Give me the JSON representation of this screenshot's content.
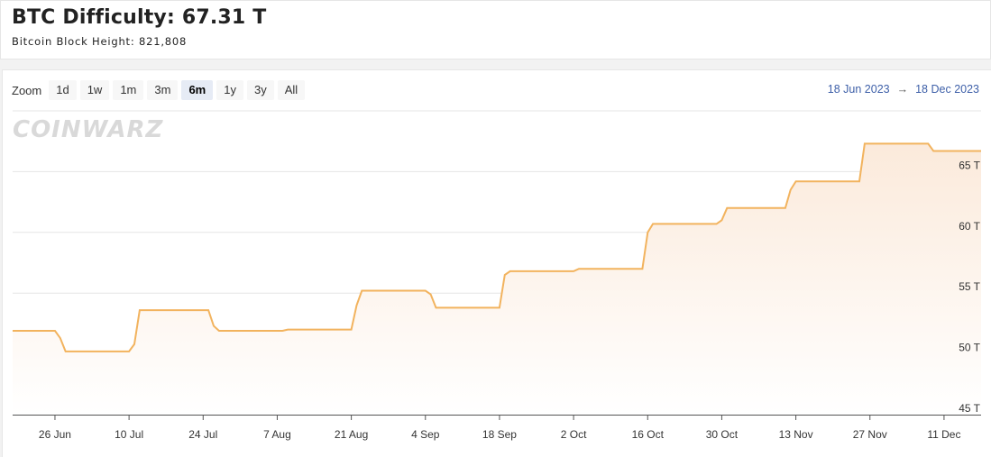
{
  "header": {
    "title": "BTC Difficulty: 67.31 T",
    "subtitle": "Bitcoin Block Height: 821,808"
  },
  "toolbar": {
    "zoom_label": "Zoom",
    "buttons": [
      "1d",
      "1w",
      "1m",
      "3m",
      "6m",
      "1y",
      "3y",
      "All"
    ],
    "active": "6m"
  },
  "range": {
    "from": "18 Jun 2023",
    "arrow": "→",
    "to": "18 Dec 2023"
  },
  "watermark": "COINWARZ",
  "colors": {
    "line": "#f2b35e",
    "fill_top": "#fbeadb",
    "fill_bottom": "#ffffff",
    "grid": "#e6e6e6",
    "range_text": "#3d5fa8"
  },
  "chart_data": {
    "type": "area",
    "title": "",
    "xlabel": "",
    "ylabel": "",
    "ylim": [
      45,
      70
    ],
    "y_ticks": [
      45,
      50,
      55,
      60,
      65
    ],
    "y_tick_labels": [
      "45 T",
      "50 T",
      "55 T",
      "60 T",
      "65 T"
    ],
    "x_ticks": [
      "2023-06-26",
      "2023-07-10",
      "2023-07-24",
      "2023-08-07",
      "2023-08-21",
      "2023-09-04",
      "2023-09-18",
      "2023-10-02",
      "2023-10-16",
      "2023-10-30",
      "2023-11-13",
      "2023-11-27",
      "2023-12-11"
    ],
    "x_tick_labels": [
      "26 Jun",
      "10 Jul",
      "24 Jul",
      "7 Aug",
      "21 Aug",
      "4 Sep",
      "18 Sep",
      "2 Oct",
      "16 Oct",
      "30 Oct",
      "13 Nov",
      "27 Nov",
      "11 Dec"
    ],
    "x_range": [
      "2023-06-18",
      "2023-12-18"
    ],
    "series": [
      {
        "points": [
          [
            "2023-06-18",
            51.9
          ],
          [
            "2023-06-26",
            51.9
          ],
          [
            "2023-06-27",
            51.3
          ],
          [
            "2023-06-28",
            50.2
          ],
          [
            "2023-07-09",
            50.2
          ],
          [
            "2023-07-10",
            50.2
          ],
          [
            "2023-07-11",
            50.8
          ],
          [
            "2023-07-12",
            53.6
          ],
          [
            "2023-07-25",
            53.6
          ],
          [
            "2023-07-26",
            52.3
          ],
          [
            "2023-07-27",
            51.9
          ],
          [
            "2023-08-08",
            51.9
          ],
          [
            "2023-08-09",
            52.0
          ],
          [
            "2023-08-21",
            52.0
          ],
          [
            "2023-08-22",
            54.0
          ],
          [
            "2023-08-23",
            55.2
          ],
          [
            "2023-09-04",
            55.2
          ],
          [
            "2023-09-05",
            54.9
          ],
          [
            "2023-09-06",
            53.8
          ],
          [
            "2023-09-18",
            53.8
          ],
          [
            "2023-09-19",
            56.5
          ],
          [
            "2023-09-20",
            56.8
          ],
          [
            "2023-10-02",
            56.8
          ],
          [
            "2023-10-03",
            57.0
          ],
          [
            "2023-10-15",
            57.0
          ],
          [
            "2023-10-16",
            60.0
          ],
          [
            "2023-10-17",
            60.7
          ],
          [
            "2023-10-29",
            60.7
          ],
          [
            "2023-10-30",
            61.0
          ],
          [
            "2023-10-31",
            62.0
          ],
          [
            "2023-11-11",
            62.0
          ],
          [
            "2023-11-12",
            63.5
          ],
          [
            "2023-11-13",
            64.2
          ],
          [
            "2023-11-25",
            64.2
          ],
          [
            "2023-11-26",
            67.3
          ],
          [
            "2023-12-08",
            67.3
          ],
          [
            "2023-12-09",
            66.7
          ],
          [
            "2023-12-18",
            66.7
          ]
        ]
      }
    ],
    "grid": true,
    "legend": "none",
    "y_axis_position": "right"
  }
}
